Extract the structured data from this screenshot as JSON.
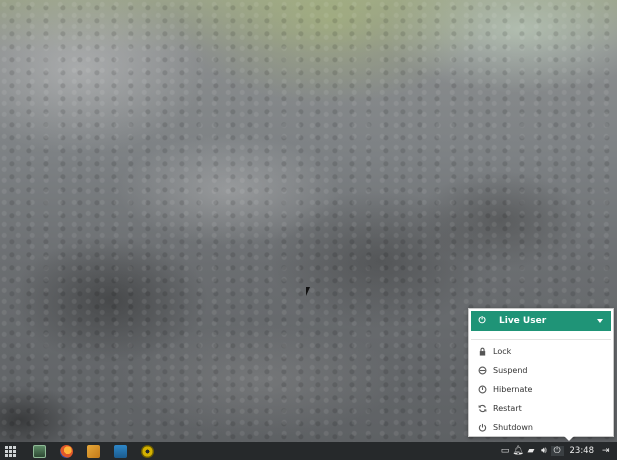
{
  "desktop": {
    "wallpaper": "rock-texture"
  },
  "session_menu": {
    "user_name": "Live User",
    "header_color": "#1f9477",
    "items": [
      {
        "label": "Lock",
        "icon": "lock-icon"
      },
      {
        "label": "Suspend",
        "icon": "suspend-icon"
      },
      {
        "label": "Hibernate",
        "icon": "hibernate-icon"
      },
      {
        "label": "Restart",
        "icon": "restart-icon"
      },
      {
        "label": "Shutdown",
        "icon": "shutdown-icon"
      }
    ]
  },
  "panel": {
    "launchers": [
      {
        "name": "terminal-icon"
      },
      {
        "name": "firefox-icon"
      },
      {
        "name": "files-icon"
      },
      {
        "name": "media-player-icon"
      },
      {
        "name": "disc-burner-icon"
      }
    ],
    "tray": [
      "window-list-icon",
      "notification-bell-icon",
      "network-icon",
      "volume-icon",
      "power-icon"
    ],
    "clock": "23:48"
  }
}
